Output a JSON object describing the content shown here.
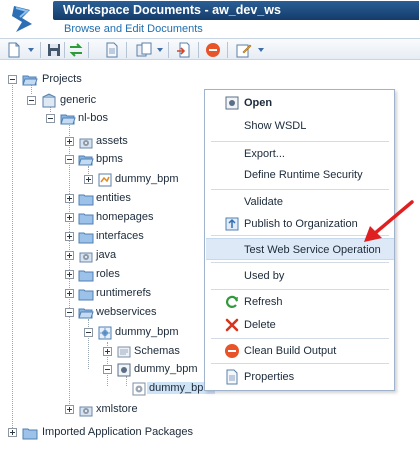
{
  "window": {
    "title": "Workspace Documents - aw_dev_ws",
    "subtitle": "Browse and Edit Documents"
  },
  "toolbar": {
    "buttons": [
      "new-document-icon",
      "save-icon",
      "sync-icon",
      "document-icon",
      "copy-icon",
      "export-icon",
      "stop-icon",
      "edit-icon"
    ]
  },
  "tree": {
    "projects": "Projects",
    "generic": "generic",
    "nl_bos": "nl-bos",
    "assets": "assets",
    "bpms": "bpms",
    "dummy_bpm_1": "dummy_bpm",
    "entities": "entities",
    "homepages": "homepages",
    "interfaces": "interfaces",
    "java": "java",
    "roles": "roles",
    "runtimerefs": "runtimerefs",
    "webservices": "webservices",
    "dummy_bpm_2": "dummy_bpm",
    "schemas": "Schemas",
    "dummy_bpm_3": "dummy_bpm",
    "dummy_bpm_4": "dummy_bpm",
    "xmlstore": "xmlstore",
    "imported": "Imported Application Packages"
  },
  "context_menu": {
    "open": "Open",
    "show_wsdl": "Show WSDL",
    "export": "Export...",
    "define_runtime_security": "Define Runtime Security",
    "validate": "Validate",
    "publish": "Publish to Organization",
    "test_ws_op": "Test Web Service Operation",
    "used_by": "Used by",
    "refresh": "Refresh",
    "delete": "Delete",
    "clean_build": "Clean Build Output",
    "properties": "Properties"
  },
  "colors": {
    "title_bar": "#1f4f82",
    "accent_blue": "#1f6fb0",
    "hover": "#dde9f6",
    "annotation_arrow": "#e02020"
  }
}
